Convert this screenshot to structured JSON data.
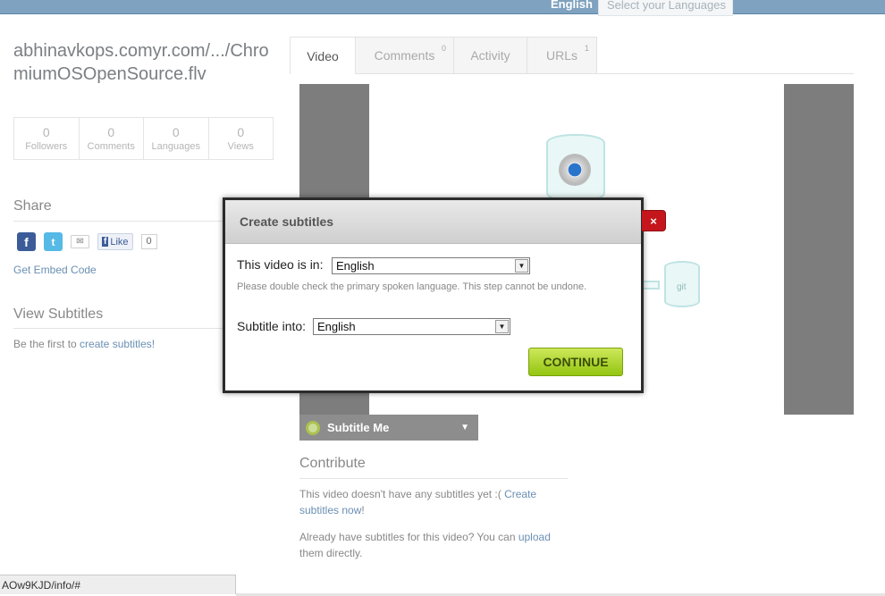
{
  "language_bar": {
    "current": "English",
    "select_placeholder": "Select your Languages"
  },
  "video": {
    "title": "abhinavkops.comyr.com/.../ChromiumOSOpenSource.flv"
  },
  "stats": [
    {
      "value": "0",
      "label": "Followers"
    },
    {
      "value": "0",
      "label": "Comments"
    },
    {
      "value": "0",
      "label": "Languages"
    },
    {
      "value": "0",
      "label": "Views"
    }
  ],
  "share": {
    "heading": "Share",
    "like_label": "Like",
    "like_count": "0",
    "embed_link": "Get Embed Code"
  },
  "view_subtitles": {
    "heading": "View Subtitles",
    "text_prefix": "Be the first to ",
    "link": "create subtitles!"
  },
  "tabs": [
    {
      "label": "Video",
      "count": ""
    },
    {
      "label": "Comments",
      "count": "0"
    },
    {
      "label": "Activity",
      "count": ""
    },
    {
      "label": "URLs",
      "count": "1"
    }
  ],
  "player": {
    "git_label": "git",
    "subtitle_me": "Subtitle Me"
  },
  "contribute": {
    "heading": "Contribute",
    "line1_prefix": "This video doesn't have any subtitles yet :( ",
    "line1_link": "Create subtitles now",
    "line1_suffix": "!",
    "line2_prefix": "Already have subtitles for this video? You can ",
    "line2_link": "upload",
    "line2_suffix": " them directly."
  },
  "modal": {
    "title": "Create subtitles",
    "close": "×",
    "video_in_label": "This video is in:",
    "video_in_value": "English",
    "hint": "Please double check the primary spoken language. This step cannot be undone.",
    "subtitle_into_label": "Subtitle into:",
    "subtitle_into_value": "English",
    "continue": "CONTINUE"
  },
  "status_bar": {
    "url": "AOw9KJD/info/#"
  },
  "colors": {
    "topbar": "#7ea2bf",
    "link": "#6a8fb3",
    "continue_green": "#94c512",
    "close_red": "#c4161c"
  }
}
